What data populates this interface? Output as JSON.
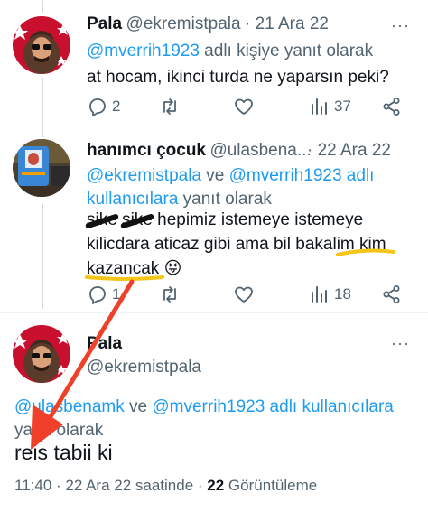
{
  "colors": {
    "accent": "#1d9bf0",
    "secondary_text": "#536471",
    "highlight": "#f5c518",
    "arrow": "#f0402a"
  },
  "tweet1": {
    "name": "Pala",
    "handle": "@ekremistpala",
    "date": "· 21 Ara 22",
    "reply_mention": "@mverrih1923",
    "reply_suffix": " adlı kişiye yanıt olarak",
    "text": "at hocam, ikinci turda ne yaparsın peki?",
    "replies": "2",
    "views": "37"
  },
  "tweet2": {
    "name": "hanımcı çocuk",
    "handle": "@ulasbena...",
    "date": "· 22 Ara 22",
    "reply_mention1": "@ekremistpala",
    "reply_and": " ve ",
    "reply_mention2": "@mverrih1923",
    "reply_mid": " adlı",
    "reply_link3": "kullanıcılara",
    "reply_suffix": " yanıt olarak",
    "text_strike1": "sike",
    "text_strike2": "sike",
    "text_line1_rest": " hepimiz istemeye istemeye",
    "text_line2_a": "kilicdara aticaz gibi ama bil bakalim ",
    "text_line2_kim": "kim",
    "text_line3": "kazancak",
    "emoji": "😝",
    "replies": "1",
    "views": "18"
  },
  "tweet3": {
    "name": "Pala",
    "handle": "@ekremistpala",
    "reply_mention1": "@ulasbenamk",
    "reply_and": " ve ",
    "reply_mention2": "@mverrih1923",
    "reply_mid": " adlı kullanıcılara",
    "reply_suffix": " yanıt olarak",
    "text": "reis tabii ki",
    "time": "11:40",
    "date_full": " · 22 Ara 22 saatinde · ",
    "views_count": "22",
    "views_label": " Görüntüleme"
  }
}
